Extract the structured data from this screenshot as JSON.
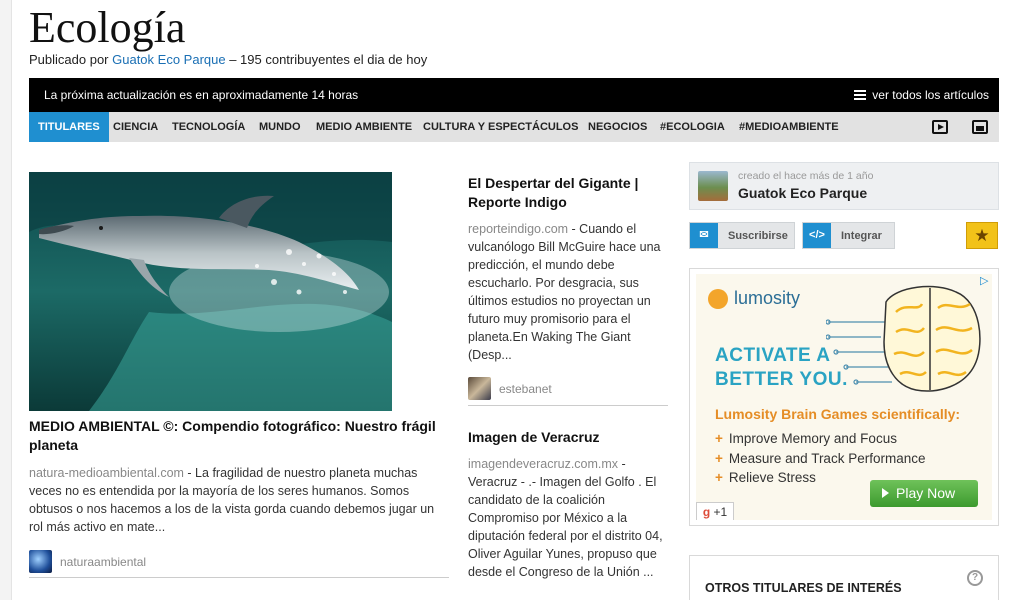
{
  "page": {
    "title": "Ecología",
    "byline_prefix": "Publicado por ",
    "byline_author": "Guatok Eco Parque",
    "byline_suffix": " – 195 contribuyentes el dia de hoy"
  },
  "topbar": {
    "update_note": "La próxima actualización es en aproximadamente 14 horas",
    "all_articles": "ver todos los artículos"
  },
  "nav": {
    "items": [
      "TITULARES",
      "CIENCIA",
      "TECNOLOGÍA",
      "MUNDO",
      "MEDIO AMBIENTE",
      "CULTURA Y ESPECTÁCULOS",
      "NEGOCIOS",
      "#ECOLOGIA",
      "#MEDIOAMBIENTE"
    ],
    "active": "TITULARES",
    "icons": [
      "video-icon",
      "image-icon"
    ]
  },
  "articles": [
    {
      "title": "MEDIO AMBIENTAL ©: Compendio fotográfico: Nuestro frágil planeta",
      "source": "natura-medioambiental.com",
      "excerpt": " - La fragilidad de nuestro planeta muchas veces no es entendida por la mayoría de los seres humanos. Somos obtusos o nos hacemos a los de la vista gorda cuando debemos jugar un rol más activo en mate...",
      "author": "naturaambiental"
    },
    {
      "title": "El Despertar del Gigante | Reporte Indigo",
      "source": "reporteindigo.com",
      "excerpt": " - Cuando el vulcanólogo Bill McGuire hace una predicción, el mundo debe escucharlo. Por desgracia, sus últimos estudios no proyectan un futuro muy promisorio para el planeta.En Waking The Giant (Desp...",
      "author": "estebanet"
    },
    {
      "title": "Imagen de Veracruz",
      "source": "imagendeveracruz.com.mx",
      "excerpt": " - Veracruz - .- Imagen del Golfo . El candidato de la coalición Compromiso por México a la diputación federal por el distrito 04, Oliver Aguilar Yunes, propuso que desde el Congreso de la Unión ..."
    }
  ],
  "sidebar": {
    "created": "creado el hace más de 1 año",
    "owner": "Guatok Eco Parque",
    "subscribe": "Suscribirse",
    "embed": "Integrar",
    "more_headlines": "OTROS TITULARES DE INTERÉS"
  },
  "ad": {
    "brand": "lumosity",
    "headline_1": "ACTIVATE A",
    "headline_2": "BETTER YOU.",
    "subhead": "Lumosity Brain Games scientifically:",
    "bullets": [
      "Improve Memory and Focus",
      "Measure and Track Performance",
      "Relieve Stress"
    ],
    "cta": "Play Now",
    "gplus": "+1"
  }
}
